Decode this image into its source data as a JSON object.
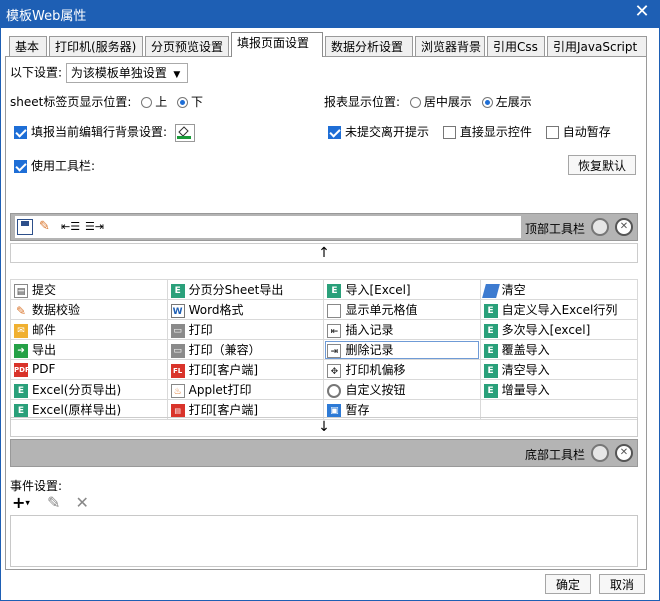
{
  "window": {
    "title": "模板Web属性",
    "close_glyph": "✕"
  },
  "tabs": [
    "基本",
    "打印机(服务器)",
    "分页预览设置",
    "填报页面设置",
    "数据分析设置",
    "浏览器背景",
    "引用Css",
    "引用JavaScript"
  ],
  "active_tab": 3,
  "settings": {
    "apply_label": "以下设置:",
    "apply_value": "为该模板单独设置",
    "sheet_pos_label": "sheet标签页显示位置:",
    "sheet_pos_options": [
      "上",
      "下"
    ],
    "sheet_pos_selected": 1,
    "report_pos_label": "报表显示位置:",
    "report_pos_options": [
      "居中展示",
      "左展示"
    ],
    "report_pos_selected": 1,
    "fill_bg_label": "填报当前编辑行背景设置:",
    "fill_bg_checked": true,
    "unsubmitted_label": "未提交离开提示",
    "unsubmitted_checked": true,
    "direct_show_label": "直接显示控件",
    "direct_show_checked": false,
    "auto_save_label": "自动暂存",
    "auto_save_checked": false,
    "use_toolbar_label": "使用工具栏:",
    "use_toolbar_checked": true,
    "restore_default": "恢复默认"
  },
  "top_toolbar_label": "顶部工具栏",
  "bottom_toolbar_label": "底部工具栏",
  "arrow_up": "↑",
  "arrow_down": "↓",
  "tool_grid": [
    [
      {
        "label": "提交",
        "icon": "submit-icon"
      },
      {
        "label": "分页分Sheet导出",
        "icon": "excel-icon"
      },
      {
        "label": "导入[Excel]",
        "icon": "excel-icon"
      },
      {
        "label": "清空",
        "icon": "eraser-icon"
      }
    ],
    [
      {
        "label": "数据校验",
        "icon": "pencil-icon"
      },
      {
        "label": "Word格式",
        "icon": "word-icon"
      },
      {
        "label": "显示单元格值",
        "icon": "cell-icon"
      },
      {
        "label": "自定义导入Excel行列",
        "icon": "excel-icon"
      }
    ],
    [
      {
        "label": "邮件",
        "icon": "mail-icon"
      },
      {
        "label": "打印",
        "icon": "printer-icon"
      },
      {
        "label": "插入记录",
        "icon": "insert-row-icon"
      },
      {
        "label": "多次导入[excel]",
        "icon": "excel-icon"
      }
    ],
    [
      {
        "label": "导出",
        "icon": "export-icon"
      },
      {
        "label": "打印（兼容）",
        "icon": "printer-icon"
      },
      {
        "label": "删除记录",
        "icon": "delete-row-icon"
      },
      {
        "label": "覆盖导入",
        "icon": "excel-icon"
      }
    ],
    [
      {
        "label": "PDF",
        "icon": "pdf-icon"
      },
      {
        "label": "打印[客户端]",
        "icon": "flash-print-icon"
      },
      {
        "label": "打印机偏移",
        "icon": "move-icon"
      },
      {
        "label": "清空导入",
        "icon": "excel-icon"
      }
    ],
    [
      {
        "label": "Excel(分页导出)",
        "icon": "excel-icon"
      },
      {
        "label": "Applet打印",
        "icon": "applet-icon"
      },
      {
        "label": "自定义按钮",
        "icon": "gear-icon"
      },
      {
        "label": "增量导入",
        "icon": "excel-icon"
      }
    ],
    [
      {
        "label": "Excel(原样导出)",
        "icon": "excel-icon"
      },
      {
        "label": "打印[客户端]",
        "icon": "pdf-print-icon"
      },
      {
        "label": "暂存",
        "icon": "save-draft-icon"
      },
      {
        "label": "",
        "icon": ""
      }
    ]
  ],
  "event_label": "事件设置:",
  "ok_button": "确定",
  "cancel_button": "取消"
}
